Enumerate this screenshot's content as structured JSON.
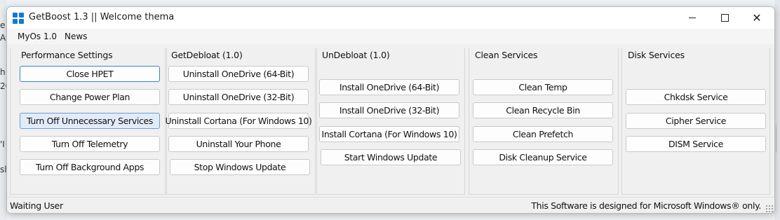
{
  "window": {
    "title": "GetBoost 1.3 || Welcome thema"
  },
  "menubar": {
    "items": [
      "MyOs 1.0",
      "News"
    ]
  },
  "panels": [
    {
      "title": "Performance Settings",
      "buttons": [
        "Close HPET",
        "Change Power Plan",
        "Turn Off Unnecessary Services",
        "Turn Off Telemetry",
        "Turn Off Background Apps"
      ]
    },
    {
      "title": "GetDebloat (1.0)",
      "buttons": [
        "Uninstall OneDrive (64-Bit)",
        "Uninstall OneDrive (32-Bit)",
        "Uninstall Cortana (For Windows 10)",
        "Uninstall Your Phone",
        "Stop Windows Update"
      ]
    },
    {
      "title": "UnDebloat (1.0)",
      "buttons": [
        "Install OneDrive (64-Bit)",
        "Install OneDrive (32-Bit)",
        "Install Cortana (For Windows 10)",
        "Start Windows Update"
      ]
    },
    {
      "title": "Clean Services",
      "buttons": [
        "Clean Temp",
        "Clean Recycle Bin",
        "Clean Prefetch",
        "Disk Cleanup Service"
      ]
    },
    {
      "title": "Disk Services",
      "buttons": [
        "Chkdsk Service",
        "Cipher Service",
        "DISM Service"
      ]
    }
  ],
  "statusbar": {
    "left": "Waiting User",
    "right": "This Software is designed for Microsoft Windows® only."
  },
  "background_fragments": [
    "e",
    "A",
    "h",
    "20",
    "'I",
    "sl"
  ],
  "colors": {
    "accent": "#1677d2",
    "focus_border": "#3a86c8",
    "hover_fill": "#e1ecf8"
  }
}
